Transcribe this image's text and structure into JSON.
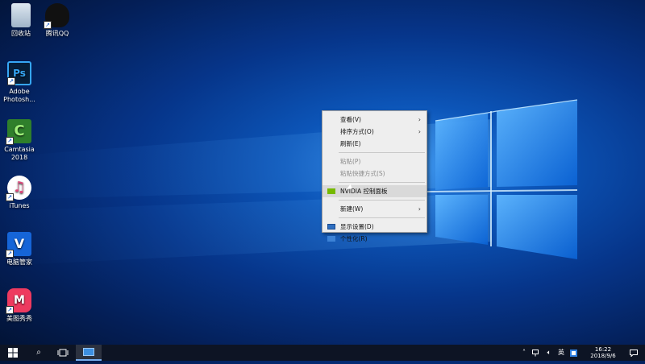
{
  "desktop": {
    "icons": [
      {
        "label": "回收站",
        "icon": "recycle-bin-icon",
        "glyph": ""
      },
      {
        "label": "腾讯QQ",
        "icon": "qq-penguin-icon",
        "glyph": ""
      },
      {
        "label": "Adobe Photosh...",
        "icon": "photoshop-icon",
        "glyph": "Ps"
      },
      {
        "label": "Camtasia 2018",
        "icon": "camtasia-icon",
        "glyph": "C"
      },
      {
        "label": "iTunes",
        "icon": "itunes-icon",
        "glyph": "♫"
      },
      {
        "label": "电脑管家",
        "icon": "pc-manager-shield-icon",
        "glyph": "V"
      },
      {
        "label": "美图秀秀",
        "icon": "meitu-icon",
        "glyph": "M"
      }
    ]
  },
  "context_menu": {
    "items": [
      {
        "label": "查看(V)",
        "submenu": true,
        "enabled": true
      },
      {
        "label": "排序方式(O)",
        "submenu": true,
        "enabled": true
      },
      {
        "label": "刷新(E)",
        "submenu": false,
        "enabled": true
      },
      {
        "label": "粘贴(P)",
        "submenu": false,
        "enabled": false
      },
      {
        "label": "粘贴快捷方式(S)",
        "submenu": false,
        "enabled": false
      },
      {
        "label": "NVIDIA 控制面板",
        "submenu": false,
        "enabled": true,
        "icon": "nvidia-icon",
        "highlighted": true
      },
      {
        "label": "新建(W)",
        "submenu": true,
        "enabled": true
      },
      {
        "label": "显示设置(D)",
        "submenu": false,
        "enabled": true,
        "icon": "display-settings-icon"
      },
      {
        "label": "个性化(R)",
        "submenu": false,
        "enabled": true,
        "icon": "personalize-icon"
      }
    ],
    "arrow_glyph": "›"
  },
  "taskbar": {
    "start_icon": "windows-start-icon",
    "search_glyph": "⌕",
    "ime_label": "英",
    "time": "16:22",
    "date": "2018/9/6",
    "notification_count_icon": "action-center-icon"
  },
  "colors": {
    "wallpaper_glow": "#2a84e6",
    "taskbar_bg": "#0d1424",
    "menu_bg": "#eeeeee",
    "nvidia_green": "#76b900"
  }
}
